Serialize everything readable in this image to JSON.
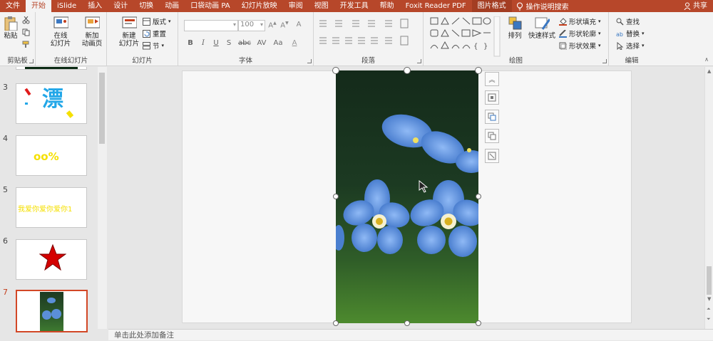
{
  "tabs": [
    "文件",
    "开始",
    "iSlide",
    "插入",
    "设计",
    "切换",
    "动画",
    "口袋动画 PA",
    "幻灯片放映",
    "审阅",
    "视图",
    "开发工具",
    "帮助",
    "Foxit Reader PDF",
    "图片格式"
  ],
  "active_tab_index": 1,
  "tell_me": "操作说明搜索",
  "share": "共享",
  "ribbon": {
    "clipboard": {
      "paste": "粘贴",
      "label": "剪贴板"
    },
    "online": {
      "btn1_l1": "在线",
      "btn1_l2": "幻灯片",
      "btn2_l1": "新加",
      "btn2_l2": "动画页",
      "label": "在线幻灯片"
    },
    "slides": {
      "new_l1": "新建",
      "new_l2": "幻灯片",
      "layout": "版式",
      "reset": "重置",
      "section": "节",
      "label": "幻灯片"
    },
    "font": {
      "font_name": "",
      "font_size": "100",
      "bold": "B",
      "italic": "I",
      "underline": "U",
      "strike": "S",
      "label": "字体"
    },
    "paragraph": {
      "label": "段落"
    },
    "drawing": {
      "arrange": "排列",
      "quick_styles": "快速样式",
      "fill": "形状填充",
      "outline": "形状轮廓",
      "effects": "形状效果",
      "label": "绘图"
    },
    "editing": {
      "find": "查找",
      "replace": "替换",
      "select": "选择",
      "label": "编辑"
    }
  },
  "slides_panel": [
    {
      "number": "3",
      "preview": "漂"
    },
    {
      "number": "4",
      "preview": "oo%"
    },
    {
      "number": "5",
      "preview": "我爱你爱你爱你1"
    },
    {
      "number": "6",
      "preview": "star"
    },
    {
      "number": "7",
      "preview": "photo"
    }
  ],
  "selected_slide": "7",
  "notes_placeholder": "单击此处添加备注",
  "colors": {
    "accent": "#b7472a",
    "selection": "#d24726"
  }
}
